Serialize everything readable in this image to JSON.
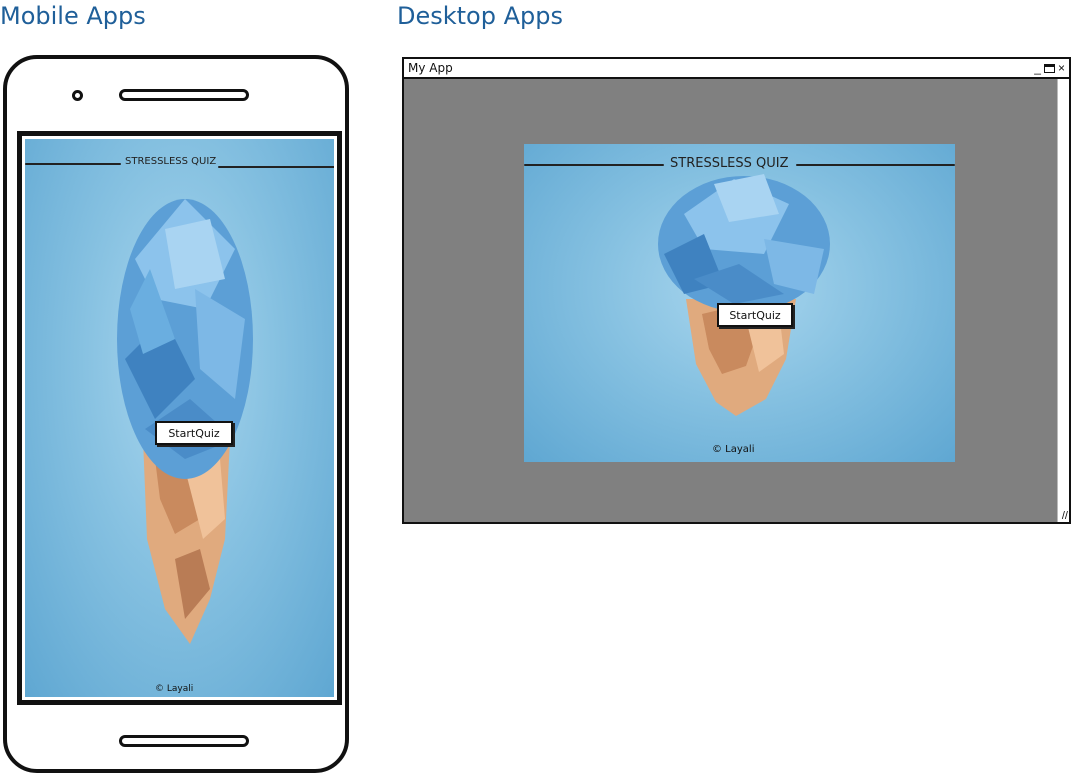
{
  "sections": {
    "mobile_title": "Mobile Apps",
    "desktop_title": "Desktop Apps"
  },
  "app": {
    "title": "STRESSLESS QUIZ",
    "start_button": "StartQuiz",
    "copyright": "© Layali"
  },
  "window": {
    "title": "My App",
    "minimize": "_",
    "close": "×"
  },
  "colors": {
    "heading": "#1f5f99",
    "background_blue": "#86c1e1",
    "desktop_gray": "#808080",
    "paper_blue": "#5c9fd6",
    "paper_skin": "#e0aa7e"
  },
  "icons": [
    "camera-icon",
    "speaker-icon",
    "home-button-icon",
    "minimize-icon",
    "maximize-icon",
    "close-icon",
    "resize-grip-icon"
  ]
}
